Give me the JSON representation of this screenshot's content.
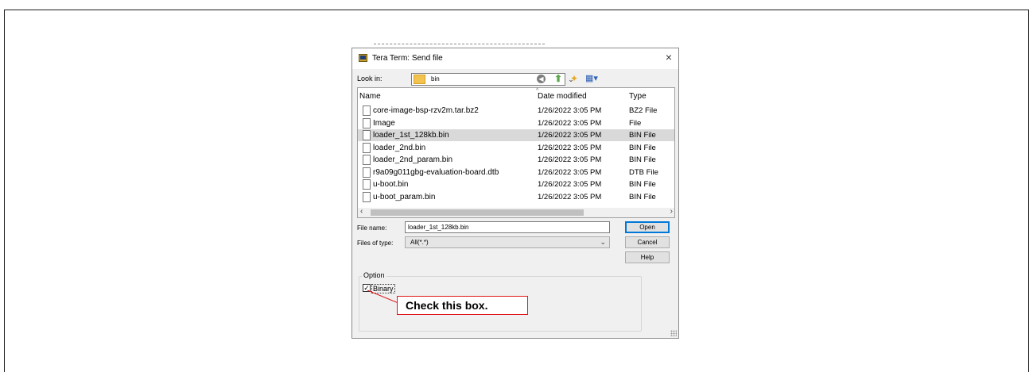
{
  "dialog": {
    "title": "Tera Term: Send file",
    "close_glyph": "×",
    "look_in_label": "Look in:",
    "look_in_value": "bin",
    "icons": [
      "app-icon",
      "folder-icon",
      "back-icon",
      "up-folder-icon",
      "new-folder-icon",
      "view-menu-icon",
      "file-icon"
    ]
  },
  "file_list": {
    "columns": [
      "Name",
      "Date modified",
      "Type"
    ],
    "rows": [
      {
        "name": "core-image-bsp-rzv2m.tar.bz2",
        "date": "1/26/2022 3:05 PM",
        "type": "BZ2 File"
      },
      {
        "name": "Image",
        "date": "1/26/2022 3:05 PM",
        "type": "File"
      },
      {
        "name": "loader_1st_128kb.bin",
        "date": "1/26/2022 3:05 PM",
        "type": "BIN File"
      },
      {
        "name": "loader_2nd.bin",
        "date": "1/26/2022 3:05 PM",
        "type": "BIN File"
      },
      {
        "name": "loader_2nd_param.bin",
        "date": "1/26/2022 3:05 PM",
        "type": "BIN File"
      },
      {
        "name": "r9a09g011gbg-evaluation-board.dtb",
        "date": "1/26/2022 3:05 PM",
        "type": "DTB File"
      },
      {
        "name": "u-boot.bin",
        "date": "1/26/2022 3:05 PM",
        "type": "BIN File"
      },
      {
        "name": "u-boot_param.bin",
        "date": "1/26/2022 3:05 PM",
        "type": "BIN File"
      }
    ],
    "selected_index": 2
  },
  "form": {
    "file_name_label": "File name:",
    "file_name_value": "loader_1st_128kb.bin",
    "files_of_type_label": "Files of type:",
    "files_of_type_value": "All(*.*)"
  },
  "buttons": {
    "open": "Open",
    "cancel": "Cancel",
    "help": "Help"
  },
  "option": {
    "group_label": "Option",
    "binary_label": "Binary",
    "binary_checked": true
  },
  "annotation": {
    "callout_text": "Check this box.",
    "color": "#e0161b"
  }
}
